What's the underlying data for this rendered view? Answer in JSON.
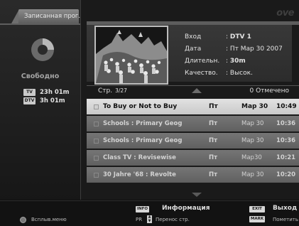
{
  "left": {
    "tab_label": "Записанная прог.",
    "free_label": "Свободно",
    "storage": [
      {
        "badge": "TV",
        "time": "23h 01m"
      },
      {
        "badge": "DTV",
        "time": "3h 01m"
      }
    ]
  },
  "brand": "ove",
  "info": {
    "input_label": "Вход",
    "input_value": "DTV 1",
    "date_label": "Дата",
    "date_value": "Пт Мар 30 2007",
    "duration_label": "Длительн.",
    "duration_value": "30m",
    "quality_label": "Качество.",
    "quality_value": "Высок."
  },
  "pagebar": {
    "label": "Стр.",
    "page": "3/27",
    "marked": "0 Отмечено"
  },
  "recordings": [
    {
      "title": "To Buy or Not to Buy",
      "day": "Пт",
      "date": "Мар 30",
      "time": "10:49",
      "selected": true
    },
    {
      "title": "Schools : Primary Geog",
      "day": "Пт",
      "date": "Мар 30",
      "time": "10:36",
      "selected": false
    },
    {
      "title": "Schools : Primary Geog",
      "day": "Пт",
      "date": "Мар 30",
      "time": "10:36",
      "selected": false
    },
    {
      "title": "Class TV : Revisewise",
      "day": "Пт",
      "date": "Мар30",
      "time": "10:21",
      "selected": false
    },
    {
      "title": "30 Jahre '68 : Revolte",
      "day": "Пт",
      "date": "Мар 30",
      "time": "10:20",
      "selected": false
    }
  ],
  "footer": {
    "menu_label": "Всплыв.меню",
    "info_key": "INFO",
    "info_label": "Информация",
    "pr_label": "PR",
    "page_move": "Перенос стр.",
    "exit_key": "EXIT",
    "exit_label": "Выход",
    "mark_key": "MARK",
    "mark_label": "Пометить"
  },
  "colors": {
    "selected_row": "#d6d6d6",
    "row": "#6b6b6b",
    "panel": "#1a1a1a"
  }
}
